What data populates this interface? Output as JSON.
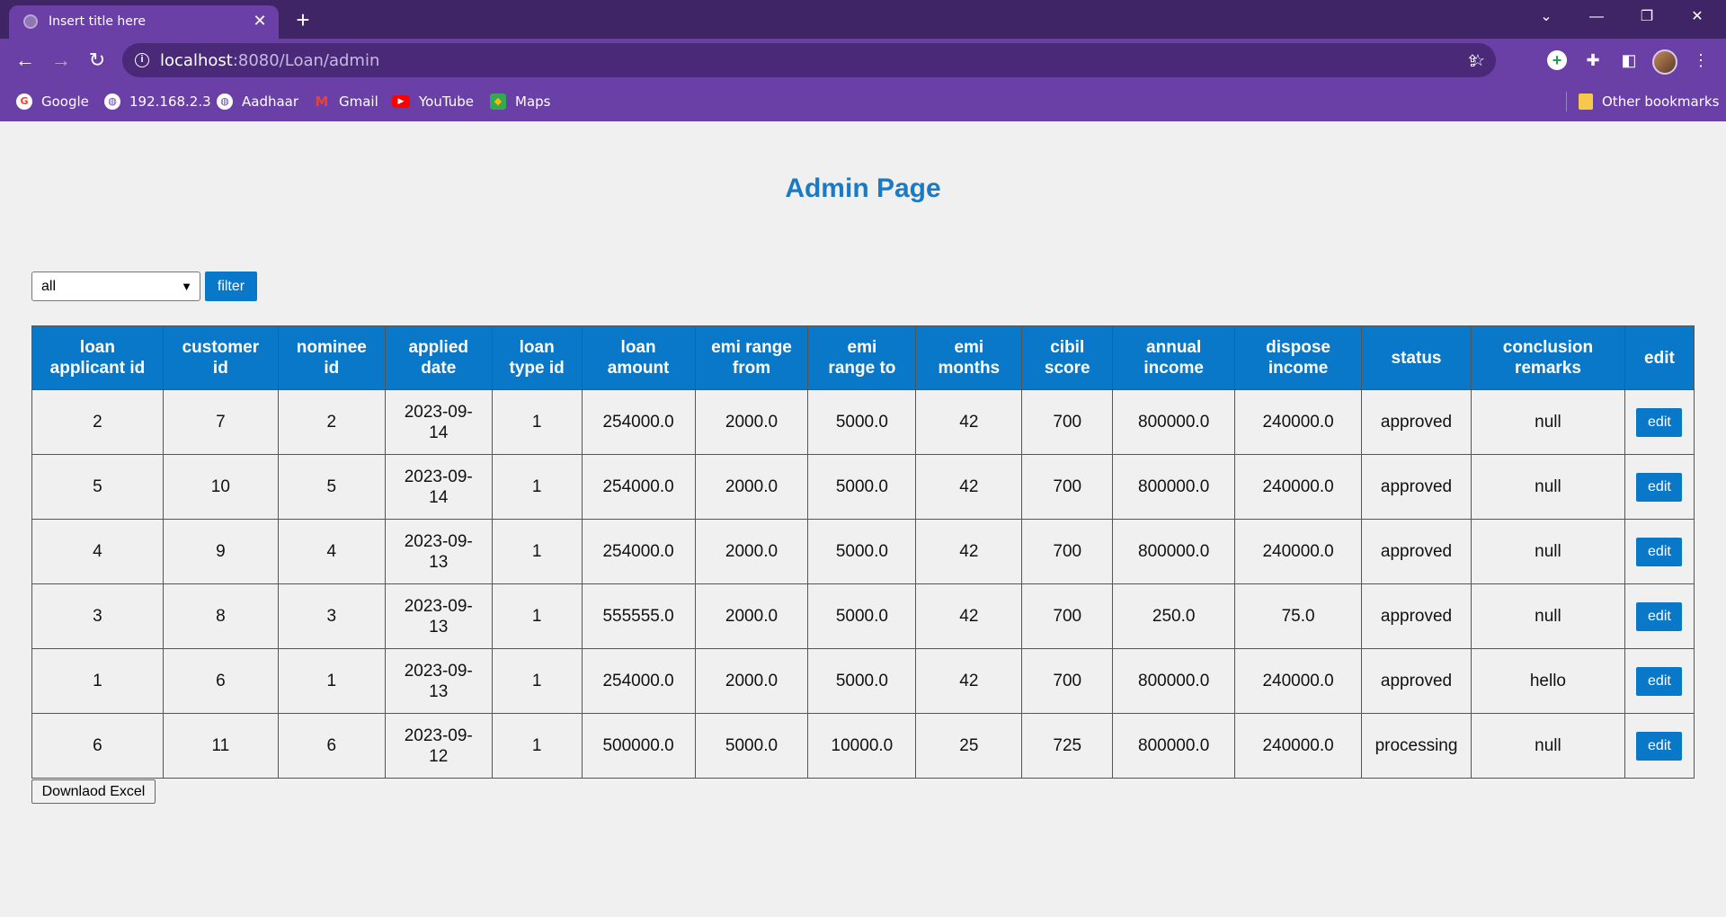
{
  "browser": {
    "tab_title": "Insert title here",
    "url_host": "localhost",
    "url_path": ":8080/Loan/admin",
    "bookmarks": [
      {
        "label": "Google",
        "icon": "google-icon",
        "color": "#ea4335"
      },
      {
        "label": "192.168.2.3",
        "icon": "globe-icon",
        "color": "#ffffff"
      },
      {
        "label": "Aadhaar",
        "icon": "globe-icon",
        "color": "#ffffff"
      },
      {
        "label": "Gmail",
        "icon": "gmail-icon",
        "color": "#ea4335"
      },
      {
        "label": "YouTube",
        "icon": "youtube-icon",
        "color": "#ff0000"
      },
      {
        "label": "Maps",
        "icon": "maps-icon",
        "color": "#34a853"
      }
    ],
    "other_bookmarks": "Other bookmarks",
    "theme_color": "#6a3fa6"
  },
  "page": {
    "title": "Admin Page",
    "filter": {
      "selected": "all",
      "button_label": "filter"
    },
    "table": {
      "headers": [
        [
          "loan",
          "applicant id"
        ],
        [
          "customer",
          "id"
        ],
        [
          "nominee",
          "id"
        ],
        [
          "applied",
          "date"
        ],
        [
          "loan",
          "type id"
        ],
        [
          "loan",
          "amount"
        ],
        [
          "emi range",
          "from"
        ],
        [
          "emi",
          "range to"
        ],
        [
          "emi",
          "months"
        ],
        [
          "cibil",
          "score"
        ],
        [
          "annual",
          "income"
        ],
        [
          "dispose",
          "income"
        ],
        [
          "status",
          ""
        ],
        [
          "conclusion",
          "remarks"
        ],
        [
          "edit",
          ""
        ]
      ],
      "rows": [
        {
          "loan_applicant_id": "2",
          "customer_id": "7",
          "nominee_id": "2",
          "applied_date_1": "2023-09-",
          "applied_date_2": "14",
          "loan_type_id": "1",
          "loan_amount": "254000.0",
          "emi_from": "2000.0",
          "emi_to": "5000.0",
          "emi_months": "42",
          "cibil_score": "700",
          "annual_income": "800000.0",
          "dispose_income": "240000.0",
          "status": "approved",
          "remarks": "null",
          "edit": "edit"
        },
        {
          "loan_applicant_id": "5",
          "customer_id": "10",
          "nominee_id": "5",
          "applied_date_1": "2023-09-",
          "applied_date_2": "14",
          "loan_type_id": "1",
          "loan_amount": "254000.0",
          "emi_from": "2000.0",
          "emi_to": "5000.0",
          "emi_months": "42",
          "cibil_score": "700",
          "annual_income": "800000.0",
          "dispose_income": "240000.0",
          "status": "approved",
          "remarks": "null",
          "edit": "edit"
        },
        {
          "loan_applicant_id": "4",
          "customer_id": "9",
          "nominee_id": "4",
          "applied_date_1": "2023-09-",
          "applied_date_2": "13",
          "loan_type_id": "1",
          "loan_amount": "254000.0",
          "emi_from": "2000.0",
          "emi_to": "5000.0",
          "emi_months": "42",
          "cibil_score": "700",
          "annual_income": "800000.0",
          "dispose_income": "240000.0",
          "status": "approved",
          "remarks": "null",
          "edit": "edit"
        },
        {
          "loan_applicant_id": "3",
          "customer_id": "8",
          "nominee_id": "3",
          "applied_date_1": "2023-09-",
          "applied_date_2": "13",
          "loan_type_id": "1",
          "loan_amount": "555555.0",
          "emi_from": "2000.0",
          "emi_to": "5000.0",
          "emi_months": "42",
          "cibil_score": "700",
          "annual_income": "250.0",
          "dispose_income": "75.0",
          "status": "approved",
          "remarks": "null",
          "edit": "edit"
        },
        {
          "loan_applicant_id": "1",
          "customer_id": "6",
          "nominee_id": "1",
          "applied_date_1": "2023-09-",
          "applied_date_2": "13",
          "loan_type_id": "1",
          "loan_amount": "254000.0",
          "emi_from": "2000.0",
          "emi_to": "5000.0",
          "emi_months": "42",
          "cibil_score": "700",
          "annual_income": "800000.0",
          "dispose_income": "240000.0",
          "status": "approved",
          "remarks": "hello",
          "edit": "edit"
        },
        {
          "loan_applicant_id": "6",
          "customer_id": "11",
          "nominee_id": "6",
          "applied_date_1": "2023-09-",
          "applied_date_2": "12",
          "loan_type_id": "1",
          "loan_amount": "500000.0",
          "emi_from": "5000.0",
          "emi_to": "10000.0",
          "emi_months": "25",
          "cibil_score": "725",
          "annual_income": "800000.0",
          "dispose_income": "240000.0",
          "status": "processing",
          "remarks": "null",
          "edit": "edit"
        }
      ]
    },
    "download_label": "Downlaod Excel",
    "accent_color": "#0a78c8",
    "title_color": "#1a7ac4"
  }
}
